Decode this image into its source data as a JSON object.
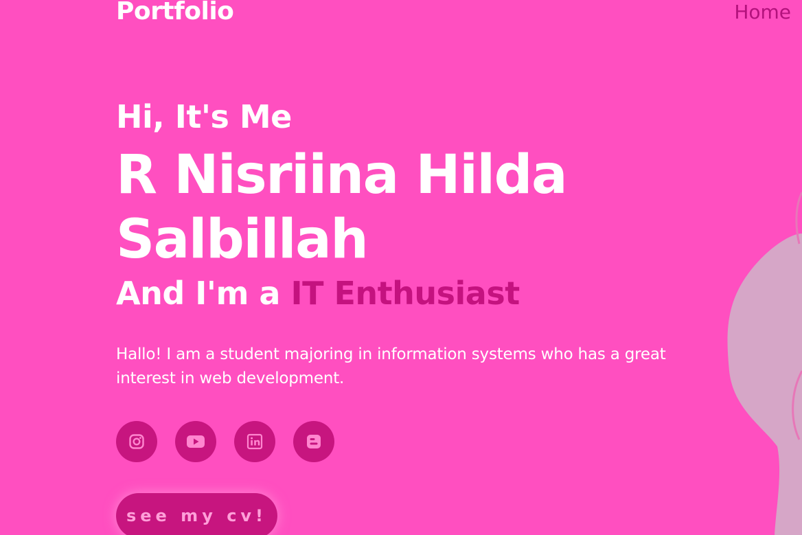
{
  "header": {
    "logo": "Portfolio",
    "nav": [
      {
        "label": "Home"
      }
    ]
  },
  "hero": {
    "greeting": "Hi, It's Me",
    "name": "R Nisriina Hilda Salbillah",
    "role_prefix": "And I'm a",
    "role": "IT Enthusiast",
    "description": "Hallo! I am a student majoring in information systems who has a great interest in web development.",
    "socials": [
      {
        "icon": "instagram-icon"
      },
      {
        "icon": "youtube-icon"
      },
      {
        "icon": "linkedin-icon"
      },
      {
        "icon": "blogger-icon"
      }
    ],
    "cv_button": "see my cv!"
  },
  "colors": {
    "background": "#ff4fc0",
    "accent": "#c4127f",
    "button": "#c7157f",
    "button_text": "#ff9fd9",
    "nav_text": "#b3127c"
  }
}
